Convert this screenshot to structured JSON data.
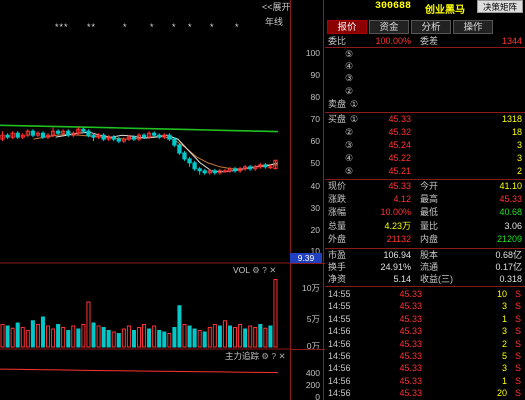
{
  "chart": {
    "expand_label": "<<展开",
    "period_label": "年线",
    "stars": [
      "***",
      "**",
      "*",
      "*",
      "*",
      "*",
      "*",
      "*"
    ],
    "price_ticks": [
      "100",
      "90",
      "80",
      "70",
      "60",
      "50",
      "40",
      "30",
      "20",
      "10"
    ],
    "price_flag": "9.39",
    "volume_label": "VOL",
    "volume_ticks": [
      "10万",
      "5万",
      "0万"
    ],
    "fund_label": "主力追踪",
    "fund_ticks": [
      "400",
      "200",
      "0"
    ]
  },
  "quote": {
    "code": "300688",
    "name": "创业黑马",
    "decision_button": "决策矩阵",
    "tabs": [
      "报价",
      "资金",
      "分析",
      "操作"
    ],
    "commission_label": "委比",
    "commission_value": "100.00%",
    "diff_label": "委差",
    "diff_value": "1344",
    "sell_label": "卖盘",
    "buy_label": "买盘",
    "sell_levels": [
      "⑤",
      "④",
      "③",
      "②"
    ],
    "buy_levels": [
      {
        "level": "①",
        "price": "45.33",
        "volume": "1318"
      },
      {
        "level": "②",
        "price": "45.32",
        "volume": "18"
      },
      {
        "level": "③",
        "price": "45.24",
        "volume": "3"
      },
      {
        "level": "④",
        "price": "45.22",
        "volume": "3"
      },
      {
        "level": "⑤",
        "price": "45.21",
        "volume": "2"
      }
    ],
    "stats": [
      {
        "l1": "现价",
        "v1": "45.33",
        "c1": "red",
        "l2": "今开",
        "v2": "41.10",
        "c2": "yellow"
      },
      {
        "l1": "涨跌",
        "v1": "4.12",
        "c1": "red",
        "l2": "最高",
        "v2": "45.33",
        "c2": "red"
      },
      {
        "l1": "涨幅",
        "v1": "10.00%",
        "c1": "red",
        "l2": "最低",
        "v2": "40.68",
        "c2": "green"
      },
      {
        "l1": "总量",
        "v1": "4.23万",
        "c1": "yellow",
        "l2": "量比",
        "v2": "3.06",
        "c2": "white"
      },
      {
        "l1": "外盘",
        "v1": "21132",
        "c1": "red",
        "l2": "内盘",
        "v2": "21209",
        "c2": "green"
      }
    ],
    "stats2": [
      {
        "l1": "市盈",
        "v1": "106.94",
        "c1": "white",
        "l2": "股本",
        "v2": "0.68亿",
        "c2": "white"
      },
      {
        "l1": "换手",
        "v1": "24.91%",
        "c1": "white",
        "l2": "流通",
        "v2": "0.17亿",
        "c2": "white"
      },
      {
        "l1": "净资",
        "v1": "5.14",
        "c1": "white",
        "l2": "收益(三)",
        "v2": "0.318",
        "c2": "white"
      }
    ],
    "trades": [
      {
        "time": "14:55",
        "price": "45.33",
        "volume": "10",
        "dir": "S"
      },
      {
        "time": "14:55",
        "price": "45.33",
        "volume": "3",
        "dir": "S"
      },
      {
        "time": "14:55",
        "price": "45.33",
        "volume": "1",
        "dir": "S"
      },
      {
        "time": "14:56",
        "price": "45.33",
        "volume": "3",
        "dir": "S"
      },
      {
        "time": "14:56",
        "price": "45.33",
        "volume": "2",
        "dir": "S"
      },
      {
        "time": "14:56",
        "price": "45.33",
        "volume": "5",
        "dir": "S"
      },
      {
        "time": "14:56",
        "price": "45.33",
        "volume": "3",
        "dir": "S"
      },
      {
        "time": "14:56",
        "price": "45.33",
        "volume": "1",
        "dir": "S"
      },
      {
        "time": "14:56",
        "price": "45.33",
        "volume": "20",
        "dir": "S"
      },
      {
        "time": "14:56",
        "price": "45.33",
        "volume": "5",
        "dir": "S"
      }
    ]
  },
  "colors": {
    "background": "#000000",
    "rise": "#ff3232",
    "fall": "#22e022",
    "volume_down": "#00c8c8",
    "ma_long": "#20c020",
    "ma_mid": "#c87832",
    "ma_short": "#e0e0e0",
    "accent_yellow": "#ffff00",
    "separator": "#8b1a1a"
  },
  "chart_data": {
    "type": "candlestick",
    "price_range": [
      0,
      100
    ],
    "candles": [
      {
        "o": 56,
        "c": 58,
        "h": 60,
        "l": 55
      },
      {
        "o": 58,
        "c": 57,
        "h": 59,
        "l": 56
      },
      {
        "o": 57,
        "c": 59,
        "h": 60,
        "l": 56
      },
      {
        "o": 59,
        "c": 57,
        "h": 60,
        "l": 56
      },
      {
        "o": 57,
        "c": 58,
        "h": 59,
        "l": 56
      },
      {
        "o": 58,
        "c": 60,
        "h": 61,
        "l": 57
      },
      {
        "o": 60,
        "c": 58,
        "h": 61,
        "l": 57
      },
      {
        "o": 58,
        "c": 59,
        "h": 60,
        "l": 57
      },
      {
        "o": 59,
        "c": 57,
        "h": 60,
        "l": 56
      },
      {
        "o": 57,
        "c": 58,
        "h": 59,
        "l": 56
      },
      {
        "o": 58,
        "c": 60,
        "h": 62,
        "l": 57
      },
      {
        "o": 60,
        "c": 59,
        "h": 61,
        "l": 58
      },
      {
        "o": 59,
        "c": 60,
        "h": 61,
        "l": 58
      },
      {
        "o": 60,
        "c": 58,
        "h": 61,
        "l": 57
      },
      {
        "o": 58,
        "c": 59,
        "h": 60,
        "l": 57
      },
      {
        "o": 59,
        "c": 61,
        "h": 62,
        "l": 58
      },
      {
        "o": 61,
        "c": 60,
        "h": 62,
        "l": 59
      },
      {
        "o": 60,
        "c": 58,
        "h": 61,
        "l": 57
      },
      {
        "o": 58,
        "c": 57,
        "h": 59,
        "l": 55
      },
      {
        "o": 57,
        "c": 58,
        "h": 59,
        "l": 56
      },
      {
        "o": 58,
        "c": 56,
        "h": 59,
        "l": 55
      },
      {
        "o": 56,
        "c": 57,
        "h": 58,
        "l": 55
      },
      {
        "o": 57,
        "c": 56,
        "h": 58,
        "l": 55
      },
      {
        "o": 56,
        "c": 55,
        "h": 57,
        "l": 54
      },
      {
        "o": 55,
        "c": 56,
        "h": 57,
        "l": 54
      },
      {
        "o": 56,
        "c": 57,
        "h": 58,
        "l": 55
      },
      {
        "o": 57,
        "c": 56,
        "h": 58,
        "l": 55
      },
      {
        "o": 56,
        "c": 58,
        "h": 59,
        "l": 55
      },
      {
        "o": 58,
        "c": 57,
        "h": 59,
        "l": 56
      },
      {
        "o": 57,
        "c": 59,
        "h": 60,
        "l": 56
      },
      {
        "o": 59,
        "c": 58,
        "h": 60,
        "l": 57
      },
      {
        "o": 58,
        "c": 57,
        "h": 59,
        "l": 56
      },
      {
        "o": 57,
        "c": 58,
        "h": 59,
        "l": 56
      },
      {
        "o": 58,
        "c": 56,
        "h": 59,
        "l": 55
      },
      {
        "o": 56,
        "c": 53,
        "h": 57,
        "l": 52
      },
      {
        "o": 53,
        "c": 49,
        "h": 54,
        "l": 48
      },
      {
        "o": 49,
        "c": 46,
        "h": 50,
        "l": 45
      },
      {
        "o": 46,
        "c": 44,
        "h": 47,
        "l": 42
      },
      {
        "o": 44,
        "c": 41,
        "h": 45,
        "l": 40
      },
      {
        "o": 41,
        "c": 40,
        "h": 42,
        "l": 38
      },
      {
        "o": 40,
        "c": 39,
        "h": 41,
        "l": 38
      },
      {
        "o": 39,
        "c": 40,
        "h": 41,
        "l": 38
      },
      {
        "o": 40,
        "c": 39,
        "h": 41,
        "l": 38
      },
      {
        "o": 39,
        "c": 40,
        "h": 41,
        "l": 38
      },
      {
        "o": 40,
        "c": 40,
        "h": 41,
        "l": 39
      },
      {
        "o": 40,
        "c": 41,
        "h": 42,
        "l": 39
      },
      {
        "o": 41,
        "c": 40,
        "h": 42,
        "l": 39
      },
      {
        "o": 40,
        "c": 41,
        "h": 42,
        "l": 39
      },
      {
        "o": 41,
        "c": 42,
        "h": 43,
        "l": 40
      },
      {
        "o": 42,
        "c": 41,
        "h": 43,
        "l": 40
      },
      {
        "o": 41,
        "c": 42,
        "h": 43,
        "l": 40
      },
      {
        "o": 42,
        "c": 43,
        "h": 44,
        "l": 41
      },
      {
        "o": 43,
        "c": 42,
        "h": 44,
        "l": 41
      },
      {
        "o": 42,
        "c": 42,
        "h": 43,
        "l": 41
      },
      {
        "o": 41.1,
        "c": 45.33,
        "h": 45.33,
        "l": 40.68
      }
    ],
    "ma_long": [
      63,
      62.8,
      62.6,
      62.4,
      62.2,
      62,
      61.8,
      61.6,
      61.4,
      61.2,
      61,
      60.8,
      60.6,
      60.4,
      60.2,
      60,
      59.8
    ],
    "ma_mid": [
      56,
      57,
      58,
      58.5,
      58,
      57.5,
      57,
      56.5,
      56,
      56.5,
      57,
      57.5,
      56,
      52,
      47,
      44,
      42,
      41,
      41,
      42,
      43,
      43
    ],
    "ma_short": [
      57,
      58,
      59,
      59.5,
      58,
      57,
      58,
      57.5,
      56.5,
      57,
      58,
      56,
      50,
      44,
      40,
      39.5,
      40,
      41,
      42,
      42.5,
      44
    ],
    "volume_range": [
      0,
      100000
    ],
    "volumes": [
      30,
      28,
      25,
      32,
      26,
      22,
      35,
      30,
      40,
      28,
      24,
      30,
      26,
      22,
      28,
      24,
      30,
      60,
      32,
      28,
      26,
      22,
      20,
      18,
      24,
      28,
      22,
      26,
      30,
      24,
      28,
      22,
      20,
      18,
      26,
      55,
      30,
      28,
      24,
      22,
      20,
      26,
      30,
      28,
      35,
      28,
      26,
      30,
      24,
      28,
      26,
      30,
      25,
      28,
      90
    ],
    "volume_up": [
      1,
      0,
      1,
      0,
      1,
      1,
      0,
      1,
      0,
      1,
      1,
      0,
      1,
      0,
      1,
      0,
      1,
      1,
      0,
      1,
      0,
      0,
      1,
      0,
      1,
      1,
      0,
      1,
      1,
      0,
      1,
      0,
      0,
      1,
      0,
      0,
      1,
      0,
      0,
      1,
      0,
      1,
      1,
      0,
      1,
      0,
      1,
      1,
      0,
      1,
      1,
      0,
      1,
      0,
      1
    ],
    "fund_range": [
      0,
      400
    ],
    "fund_line": [
      350,
      348,
      345,
      342,
      340,
      338,
      335,
      332,
      330,
      328,
      326,
      324,
      322,
      320,
      318,
      316,
      314,
      312,
      310,
      308
    ]
  }
}
